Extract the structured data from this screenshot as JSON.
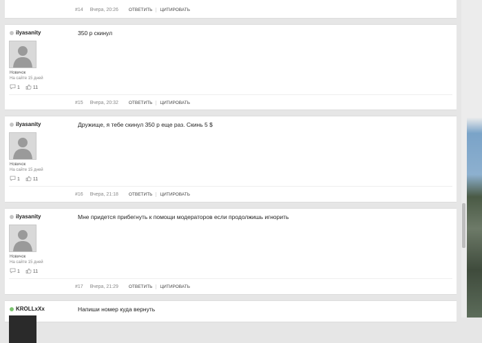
{
  "labels": {
    "reply": "ОТВЕТИТЬ",
    "quote": "ЦИТИРОВАТЬ"
  },
  "top_footer": {
    "num": "#14",
    "date": "Вчера, 20:26"
  },
  "posts": [
    {
      "author": "ilyasanity",
      "online": false,
      "rank": "Новичок",
      "member_since": "На сайте 15 дней",
      "comments": "1",
      "likes": "11",
      "text": "350 р скинул",
      "num": "#15",
      "date": "Вчера, 20:32"
    },
    {
      "author": "ilyasanity",
      "online": false,
      "rank": "Новичок",
      "member_since": "На сайте 15 дней",
      "comments": "1",
      "likes": "11",
      "text": "Дружище, я тебе скинул 350 р еще раз. Скинь 5 $",
      "num": "#16",
      "date": "Вчера, 21:18"
    },
    {
      "author": "ilyasanity",
      "online": false,
      "rank": "Новичок",
      "member_since": "На сайте 15 дней",
      "comments": "1",
      "likes": "11",
      "text": "Мне придется прибегнуть к помощи модераторов если продолжишь игнорить",
      "num": "#17",
      "date": "Вчера, 21:29"
    },
    {
      "author": "KROLLxXx",
      "online": true,
      "text": "Напиши номер куда вернуть"
    }
  ],
  "colors": {
    "online": "#7bc36f",
    "offline": "#c5c5c5",
    "background": "#e6e6e6"
  }
}
